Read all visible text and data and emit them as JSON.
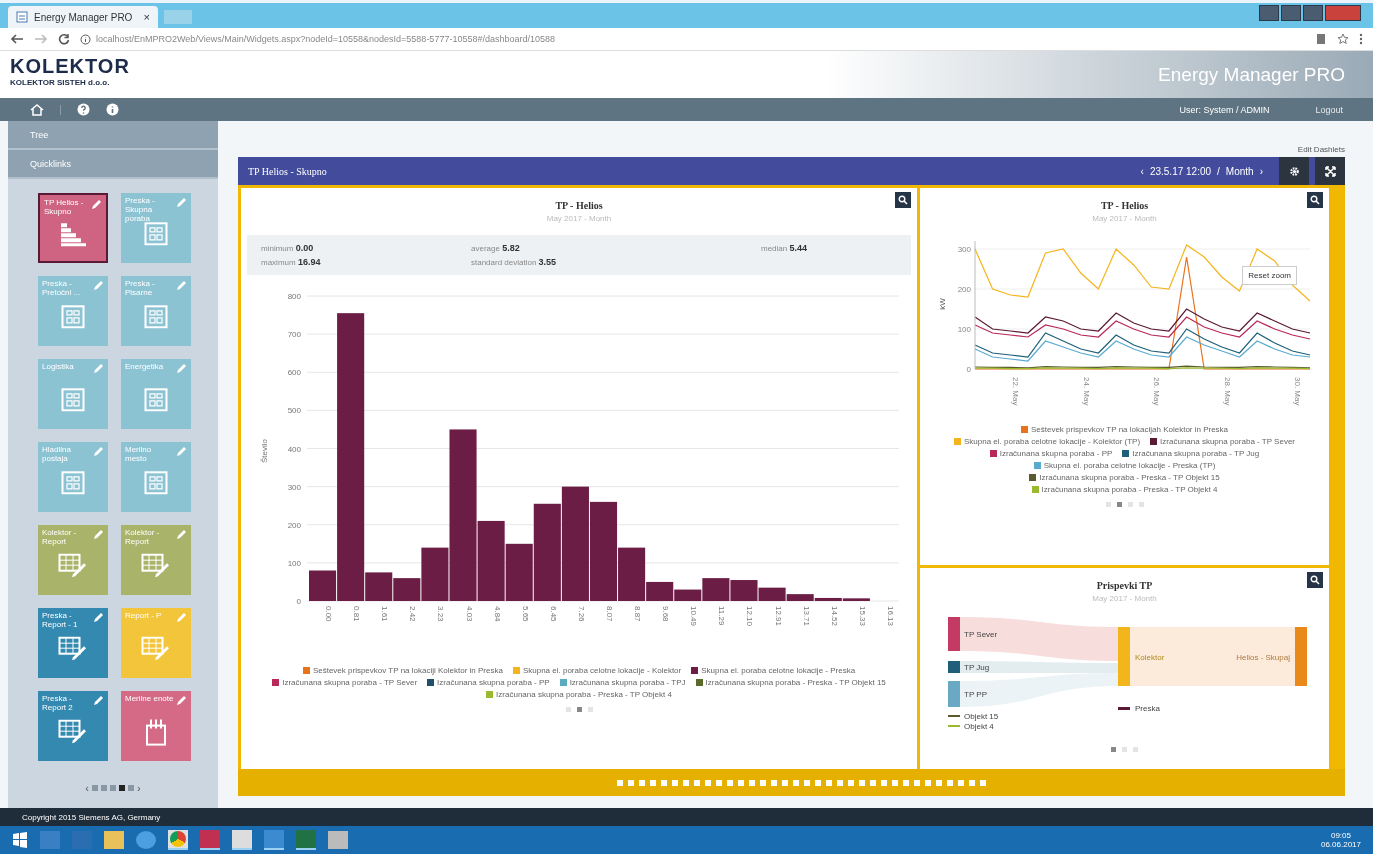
{
  "browser": {
    "tab_title": "Energy Manager PRO",
    "tab_close": "×",
    "url": "localhost/EnMPRO2Web/Views/Main/Widgets.aspx?nodeId=10558&nodesId=5588-5777-10558#/dashboard/10588"
  },
  "header": {
    "logo": "KOLEKTOR",
    "company": "KOLEKTOR SISTEH d.o.o.",
    "product": "Energy Manager PRO"
  },
  "nav": {
    "user": "User: System / ADMIN",
    "logout": "Logout"
  },
  "sidebar": {
    "sections": [
      "Tree",
      "Quicklinks"
    ],
    "tiles": [
      {
        "label": "TP Helios - Skupno",
        "kind": "tiers",
        "color": "#cf6482",
        "selected": true
      },
      {
        "label": "Preska - Skupna poraba",
        "kind": "meter",
        "color": "#8cc3d3",
        "selected": false
      },
      {
        "label": "Preska - Pretočni ...",
        "kind": "meter",
        "color": "#8cc3d3",
        "selected": false
      },
      {
        "label": "Preska - Pisarne",
        "kind": "meter",
        "color": "#8cc3d3",
        "selected": false
      },
      {
        "label": "Logistika",
        "kind": "meter",
        "color": "#8cc3d3",
        "selected": false
      },
      {
        "label": "Energetika",
        "kind": "meter",
        "color": "#8cc3d3",
        "selected": false
      },
      {
        "label": "Hladilna postaja",
        "kind": "meter",
        "color": "#8cc3d3",
        "selected": false
      },
      {
        "label": "Merilno mesto",
        "kind": "meter",
        "color": "#8cc3d3",
        "selected": false
      },
      {
        "label": "Kolektor - Report",
        "kind": "report",
        "color": "#a9b46a",
        "selected": false
      },
      {
        "label": "Kolektor - Report",
        "kind": "report",
        "color": "#a9b46a",
        "selected": false
      },
      {
        "label": "Preska - Report - 1",
        "kind": "report",
        "color": "#3489b0",
        "selected": false
      },
      {
        "label": "Report - P",
        "kind": "report",
        "color": "#f3c53a",
        "selected": false
      },
      {
        "label": "Preska - Report 2",
        "kind": "report",
        "color": "#3489b0",
        "selected": false
      },
      {
        "label": "Merilne enote",
        "kind": "device",
        "color": "#d46a86",
        "selected": false
      }
    ],
    "pager": {
      "prev": "‹",
      "next": "›",
      "pages": [
        {
          "selected": false
        },
        {
          "selected": false
        },
        {
          "selected": false
        },
        {
          "selected": true
        },
        {
          "selected": false
        }
      ]
    }
  },
  "dashboard": {
    "edit_link": "Edit Dashlets",
    "panel_title": "TP Helios - Skupno",
    "prev": "‹",
    "date": "23.5.17 12:00",
    "separator": "/",
    "period": "Month",
    "next": "›"
  },
  "histogram": {
    "title": "TP - Helios",
    "subtitle": "May 2017 - Month",
    "stats": [
      {
        "label": "minimum",
        "value": "0.00"
      },
      {
        "label": "average",
        "value": "5.82"
      },
      {
        "label": "median",
        "value": "5.44"
      },
      {
        "label": "maximum",
        "value": "16.94"
      },
      {
        "label": "standard deviation",
        "value": "3.55"
      }
    ],
    "chart_data": {
      "type": "bar",
      "grid": true,
      "ylabel": "Število",
      "yticks": [
        0,
        100,
        200,
        300,
        400,
        500,
        600,
        700,
        800
      ],
      "ylim": [
        0,
        800
      ],
      "categories": [
        "0.00",
        "0.81",
        "1.61",
        "2.42",
        "3.23",
        "4.03",
        "4.84",
        "5.65",
        "6.45",
        "7.26",
        "8.07",
        "8.87",
        "9.68",
        "10.49",
        "11.29",
        "12.10",
        "12.91",
        "13.71",
        "14.52",
        "15.33",
        "16.13"
      ],
      "series": [
        {
          "name": "Skupna el. poraba celotne lokacije - Preska",
          "color": "#6b1d45",
          "values": [
            80,
            755,
            75,
            60,
            140,
            450,
            210,
            150,
            255,
            300,
            260,
            140,
            50,
            30,
            60,
            55,
            35,
            18,
            8,
            7,
            0
          ]
        }
      ]
    },
    "legend_before": [
      {
        "label": "Seštevek prispevkov TP na lokaciji Kolektor in Preska",
        "color": "#e8731a"
      },
      {
        "label": "Skupna el. poraba celotne lokacije - Kolektor",
        "color": "#f3b51c"
      }
    ],
    "legend": [
      {
        "label": "Izračunana skupna poraba - TP Sever",
        "color": "#b8285a"
      },
      {
        "label": "Izračunana skupna poraba - PP",
        "color": "#1f4f6a"
      },
      {
        "label": "Izračunana skupna poraba - TPJ",
        "color": "#5aaac0"
      },
      {
        "label": "Izračunana skupna poraba - Preska - TP Objekt 15",
        "color": "#5a6a2a"
      },
      {
        "label": "Izračunana skupna poraba - Preska - TP Objekt 4",
        "color": "#9ab830"
      }
    ],
    "pages": [
      {
        "selected": false
      },
      {
        "selected": true
      },
      {
        "selected": false
      }
    ]
  },
  "line_chart": {
    "title": "TP - Helios",
    "subtitle": "May 2017 - Month",
    "reset_button": "Reset zoom",
    "chart_data": {
      "type": "line",
      "grid": true,
      "ylabel": "kW",
      "ylim": [
        0,
        320
      ],
      "yticks": [
        0,
        100,
        200,
        300
      ],
      "categories": [
        null,
        null,
        "22. May",
        null,
        null,
        null,
        "24. May",
        null,
        null,
        null,
        "26. May",
        null,
        null,
        null,
        "28. May",
        null,
        null,
        null,
        "30. May",
        null
      ],
      "series": [
        {
          "name": "Seštevek prispevkov TP na lokacijah Kolektor in Preska",
          "color": "#e8731a",
          "values": [
            0,
            0,
            0,
            0,
            0,
            0,
            0,
            0,
            0,
            0,
            0,
            0,
            280,
            0,
            0,
            0,
            0,
            0,
            0,
            0
          ]
        },
        {
          "name": "Skupna el. poraba celotne lokacije - Kolektor (TP)",
          "color": "#f3b51c",
          "values": [
            300,
            200,
            185,
            180,
            290,
            300,
            240,
            200,
            300,
            260,
            205,
            200,
            310,
            280,
            230,
            195,
            300,
            270,
            210,
            170
          ]
        },
        {
          "name": "Izračunana skupna poraba - TP Sever",
          "color": "#5a1a35",
          "values": [
            130,
            100,
            95,
            90,
            130,
            120,
            100,
            95,
            140,
            115,
            100,
            95,
            150,
            125,
            105,
            95,
            140,
            120,
            100,
            90
          ]
        },
        {
          "name": "Izračunana skupna poraba - PP",
          "color": "#b8285a",
          "values": [
            110,
            90,
            85,
            80,
            110,
            100,
            85,
            80,
            120,
            100,
            85,
            80,
            130,
            105,
            90,
            80,
            120,
            100,
            85,
            75
          ]
        },
        {
          "name": "Izračunana skupna poraba - TP Jug",
          "color": "#1f5f7a",
          "values": [
            60,
            40,
            35,
            30,
            90,
            70,
            50,
            40,
            85,
            60,
            45,
            40,
            100,
            75,
            55,
            40,
            90,
            65,
            45,
            35
          ]
        },
        {
          "name": "Skupna el. poraba celotne lokacije - Preska (TP)",
          "color": "#5aaad0",
          "values": [
            50,
            30,
            25,
            20,
            70,
            55,
            40,
            30,
            70,
            50,
            35,
            30,
            80,
            60,
            45,
            30,
            70,
            50,
            35,
            30
          ]
        },
        {
          "name": "Izračunana skupna poraba - Preska - TP Objekt 15",
          "color": "#5a5a30",
          "values": [
            5,
            4,
            4,
            3,
            6,
            5,
            4,
            4,
            6,
            5,
            4,
            4,
            7,
            5,
            4,
            4,
            6,
            5,
            4,
            3
          ]
        },
        {
          "name": "Izračunana skupna poraba - Preska - TP Objekt 4",
          "color": "#9ab830",
          "values": [
            2,
            2,
            1,
            1,
            3,
            2,
            2,
            1,
            3,
            2,
            2,
            1,
            3,
            2,
            2,
            1,
            3,
            2,
            2,
            1
          ]
        }
      ]
    },
    "pages": [
      {
        "selected": false
      },
      {
        "selected": true
      },
      {
        "selected": false
      },
      {
        "selected": false
      }
    ]
  },
  "sankey": {
    "title": "Prispevki TP",
    "subtitle": "May 2017 - Month",
    "nodes": [
      "TP Sever",
      "TP Jug",
      "TP PP",
      "Objekt 15",
      "Objekt 4",
      "Kolektor",
      "Preska",
      "Helios - Skupaj"
    ],
    "pages": [
      {
        "selected": true
      },
      {
        "selected": false
      },
      {
        "selected": false
      }
    ]
  },
  "footer": {
    "copyright": "Copyright 2015 Siemens AG, Germany"
  },
  "taskbar": {
    "time": "09:05",
    "date": "06.06.2017"
  }
}
